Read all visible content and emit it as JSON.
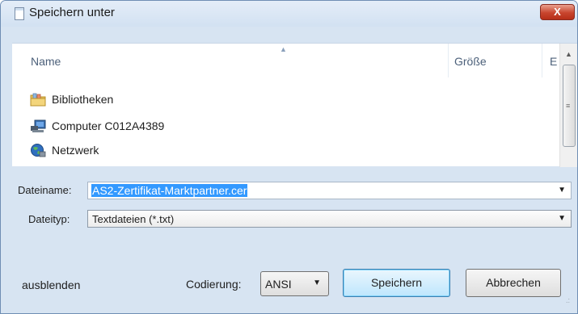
{
  "window": {
    "title": "Speichern unter",
    "close_label": "X"
  },
  "file_list": {
    "columns": [
      "Name",
      "Größe",
      "E"
    ],
    "items": [
      {
        "label": "Bibliotheken",
        "icon": "libraries-icon"
      },
      {
        "label": "Computer C012A4389",
        "icon": "computer-icon"
      },
      {
        "label": "Netzwerk",
        "icon": "network-icon"
      }
    ]
  },
  "form": {
    "filename_label": "Dateiname:",
    "filename_value": "AS2-Zertifikat-Marktpartner.cer",
    "filetype_label": "Dateityp:",
    "filetype_value": "Textdateien (*.txt)",
    "encoding_label": "Codierung:",
    "encoding_value": "ANSI"
  },
  "footer": {
    "hide_folders_label": "ausblenden",
    "save_label": "Speichern",
    "cancel_label": "Abbrechen"
  },
  "colors": {
    "selection": "#3399ff",
    "close_button": "#c8452e",
    "dialog_background": "#d7e4f2"
  }
}
